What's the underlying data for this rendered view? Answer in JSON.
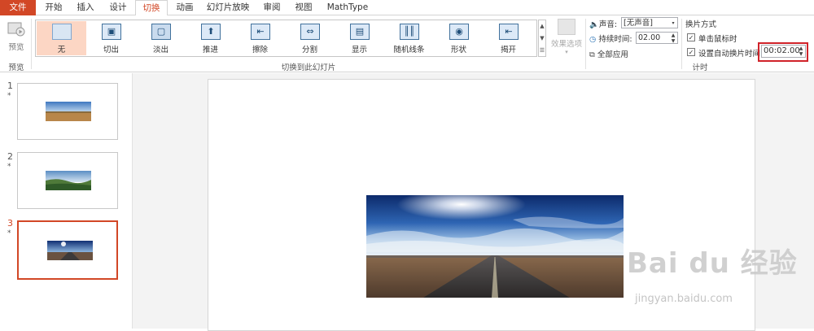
{
  "tabs": [
    "文件",
    "开始",
    "插入",
    "设计",
    "切换",
    "动画",
    "幻灯片放映",
    "审阅",
    "视图",
    "MathType"
  ],
  "active_tab": "切换",
  "ribbon": {
    "preview_label": "预览",
    "preview_group": "预览",
    "gallery_group": "切换到此幻灯片",
    "effects_label": "效果选项",
    "transitions": [
      {
        "label": "无",
        "icon": "none-transition-icon"
      },
      {
        "label": "切出",
        "icon": "cut-transition-icon"
      },
      {
        "label": "淡出",
        "icon": "fade-transition-icon"
      },
      {
        "label": "推进",
        "icon": "push-transition-icon"
      },
      {
        "label": "擦除",
        "icon": "wipe-transition-icon"
      },
      {
        "label": "分割",
        "icon": "split-transition-icon"
      },
      {
        "label": "显示",
        "icon": "reveal-transition-icon"
      },
      {
        "label": "随机线条",
        "icon": "random-bars-icon"
      },
      {
        "label": "形状",
        "icon": "shape-transition-icon"
      },
      {
        "label": "揭开",
        "icon": "uncover-transition-icon"
      }
    ],
    "selected_transition": "无",
    "timing": {
      "sound_label": "声音:",
      "sound_value": "[无声音]",
      "duration_label": "持续时间:",
      "duration_value": "02.00",
      "apply_all": "全部应用",
      "advance_title": "换片方式",
      "on_click": "单击鼠标时",
      "after_label": "设置自动换片时间:",
      "after_value": "00:02.00",
      "group": "计时"
    }
  },
  "slides": [
    {
      "number": "1",
      "star": "*"
    },
    {
      "number": "2",
      "star": "*"
    },
    {
      "number": "3",
      "star": "*"
    }
  ],
  "watermark": {
    "brand": "Bai du 经验",
    "url": "jingyan.baidu.com"
  },
  "colors": {
    "accent": "#d24726",
    "highlight_box": "#d0232a",
    "selected_item": "#fcd6c4"
  }
}
